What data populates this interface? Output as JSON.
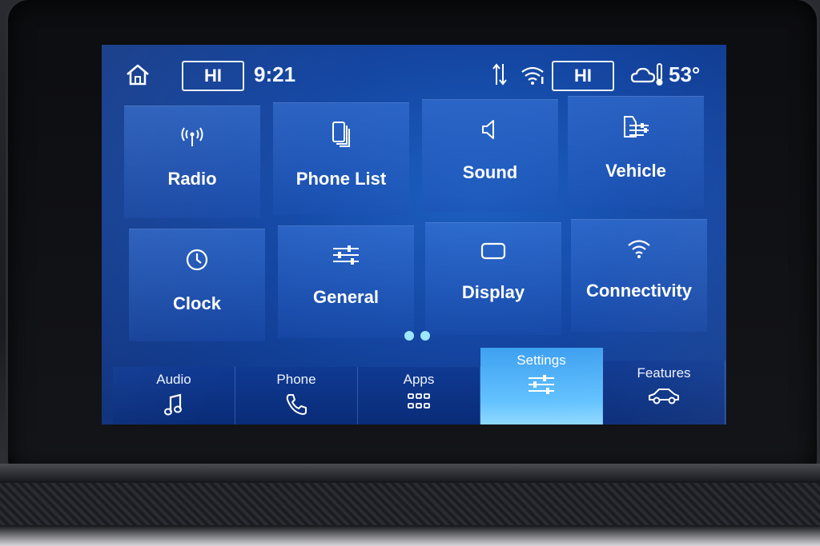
{
  "status_bar": {
    "driver_temp": "HI",
    "time": "9:21",
    "passenger_temp": "HI",
    "outside_temp": "53°"
  },
  "tiles": [
    {
      "label": "Radio",
      "icon": "radio-antenna-icon"
    },
    {
      "label": "Phone List",
      "icon": "phone-list-icon"
    },
    {
      "label": "Sound",
      "icon": "speaker-icon"
    },
    {
      "label": "Vehicle",
      "icon": "vehicle-settings-icon"
    },
    {
      "label": "Clock",
      "icon": "clock-icon"
    },
    {
      "label": "General",
      "icon": "sliders-icon"
    },
    {
      "label": "Display",
      "icon": "display-icon"
    },
    {
      "label": "Connectivity",
      "icon": "wifi-icon"
    }
  ],
  "nav": [
    {
      "label": "Audio",
      "icon": "music-note-icon"
    },
    {
      "label": "Phone",
      "icon": "phone-icon"
    },
    {
      "label": "Apps",
      "icon": "apps-grid-icon"
    },
    {
      "label": "Settings",
      "icon": "sliders-icon",
      "active": true
    },
    {
      "label": "Features",
      "icon": "car-icon"
    }
  ],
  "colors": {
    "screen_bg": "#1446a2",
    "active_tab": "#63c2ff",
    "page_dot": "#9ee6ff"
  }
}
